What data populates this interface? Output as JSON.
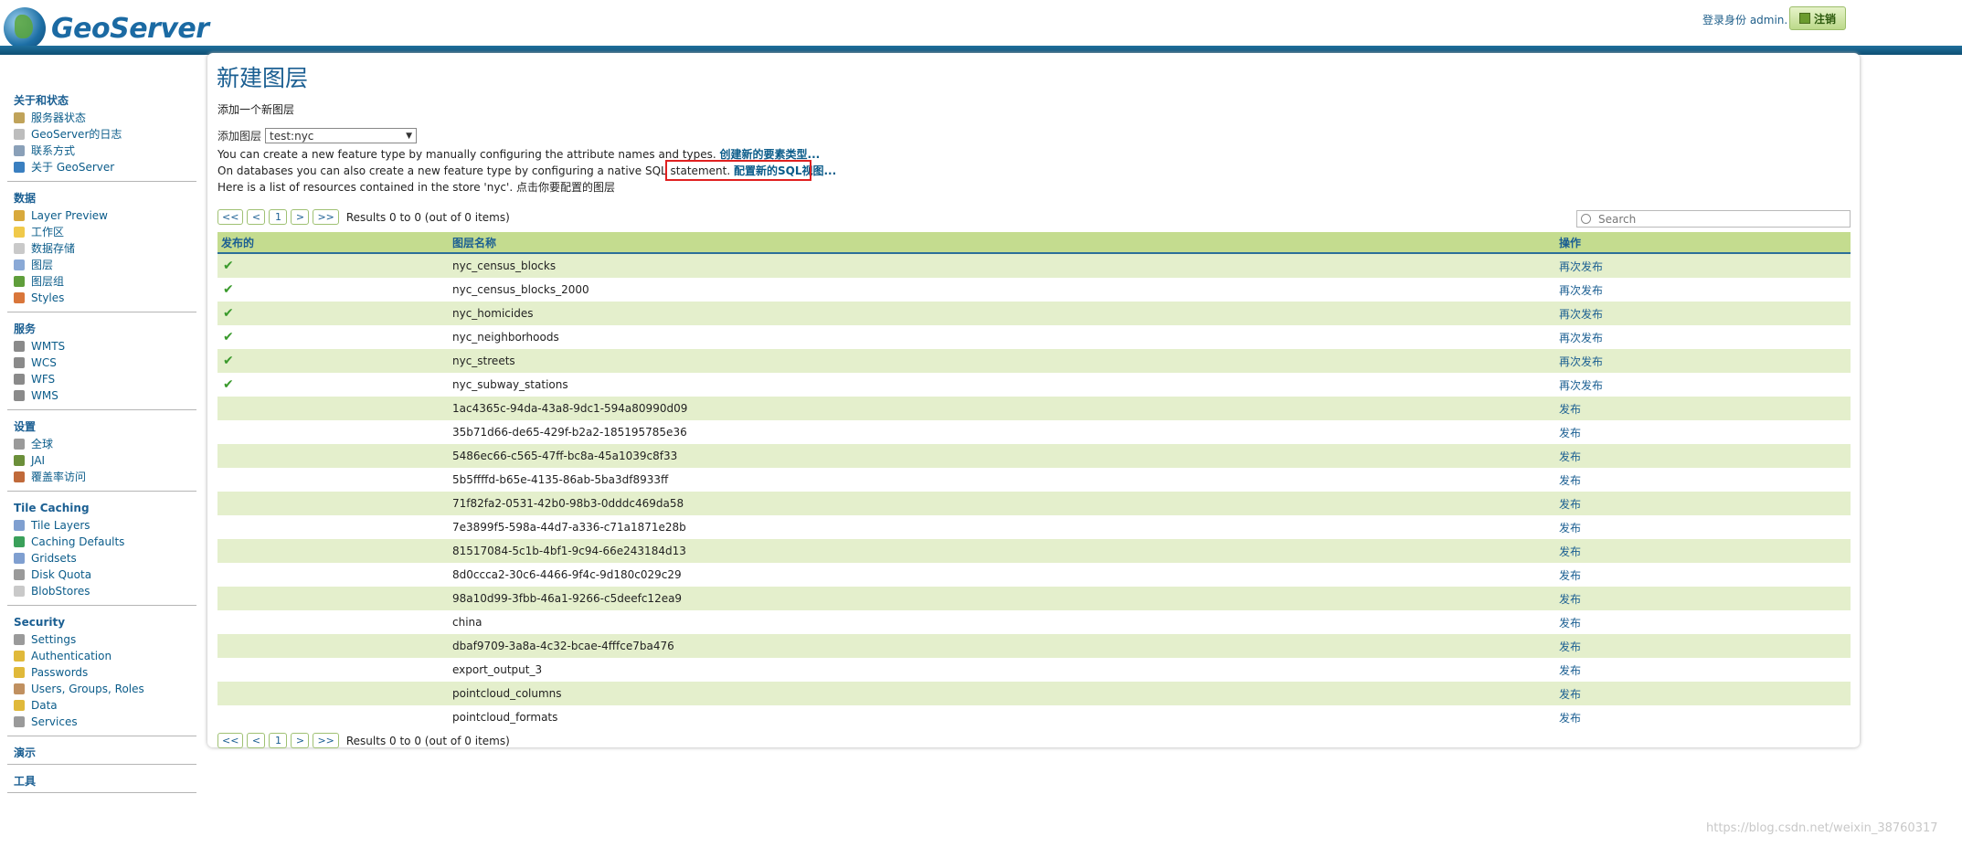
{
  "header": {
    "logo_text": "GeoServer",
    "login_text": "登录身份 admin.",
    "logout_label": "注销"
  },
  "sidebar": {
    "sections": [
      {
        "title": "关于和状态",
        "items": [
          {
            "label": "服务器状态",
            "icon": "server-status-icon",
            "color": "#c0a35a"
          },
          {
            "label": "GeoServer的日志",
            "icon": "log-icon",
            "color": "#bdbdbd"
          },
          {
            "label": "联系方式",
            "icon": "contact-icon",
            "color": "#8aa0b8"
          },
          {
            "label": "关于 GeoServer",
            "icon": "about-icon",
            "color": "#3a7fc0"
          }
        ]
      },
      {
        "title": "数据",
        "items": [
          {
            "label": "Layer Preview",
            "icon": "layer-preview-icon",
            "color": "#d8a93c"
          },
          {
            "label": "工作区",
            "icon": "folder-icon",
            "color": "#f0c94a"
          },
          {
            "label": "数据存储",
            "icon": "datastore-icon",
            "color": "#c9c9c9"
          },
          {
            "label": "图层",
            "icon": "layers-icon",
            "color": "#8aa9d6"
          },
          {
            "label": "图层组",
            "icon": "layergroup-icon",
            "color": "#5f9e3b"
          },
          {
            "label": "Styles",
            "icon": "styles-icon",
            "color": "#d9763a"
          }
        ]
      },
      {
        "title": "服务",
        "items": [
          {
            "label": "WMTS",
            "icon": "wmts-icon",
            "color": "#8a8a8a"
          },
          {
            "label": "WCS",
            "icon": "wcs-icon",
            "color": "#8a8a8a"
          },
          {
            "label": "WFS",
            "icon": "wfs-icon",
            "color": "#8a8a8a"
          },
          {
            "label": "WMS",
            "icon": "wms-icon",
            "color": "#8a8a8a"
          }
        ]
      },
      {
        "title": "设置",
        "items": [
          {
            "label": "全球",
            "icon": "global-icon",
            "color": "#9a9a9a"
          },
          {
            "label": "JAI",
            "icon": "jai-icon",
            "color": "#6b8f3a"
          },
          {
            "label": "覆盖率访问",
            "icon": "coverage-access-icon",
            "color": "#c06a3a"
          }
        ]
      },
      {
        "title": "Tile Caching",
        "items": [
          {
            "label": "Tile Layers",
            "icon": "tile-layers-icon",
            "color": "#7f9fd0"
          },
          {
            "label": "Caching Defaults",
            "icon": "caching-defaults-icon",
            "color": "#3aa05a"
          },
          {
            "label": "Gridsets",
            "icon": "gridsets-icon",
            "color": "#7f9fd0"
          },
          {
            "label": "Disk Quota",
            "icon": "disk-quota-icon",
            "color": "#9a9a9a"
          },
          {
            "label": "BlobStores",
            "icon": "blobstores-icon",
            "color": "#c9c9c9"
          }
        ]
      },
      {
        "title": "Security",
        "items": [
          {
            "label": "Settings",
            "icon": "wrench-icon",
            "color": "#9a9a9a"
          },
          {
            "label": "Authentication",
            "icon": "authentication-icon",
            "color": "#e0b93a"
          },
          {
            "label": "Passwords",
            "icon": "passwords-icon",
            "color": "#e0b93a"
          },
          {
            "label": "Users, Groups, Roles",
            "icon": "users-icon",
            "color": "#c09060"
          },
          {
            "label": "Data",
            "icon": "data-security-icon",
            "color": "#e0b93a"
          },
          {
            "label": "Services",
            "icon": "services-security-icon",
            "color": "#9a9a9a"
          }
        ]
      },
      {
        "title": "演示",
        "items": []
      },
      {
        "title": "工具",
        "items": []
      }
    ]
  },
  "main": {
    "title": "新建图层",
    "subtitle": "添加一个新图层",
    "add_layer_label": "添加图层",
    "store_value": "test:nyc",
    "line1_text": "You can create a new feature type by manually configuring the attribute names and types.",
    "line1_link": "创建新的要素类型...",
    "line2_text": "On databases you can also create a new feature type by configuring a native SQL statement.",
    "line2_link": "配置新的SQL视图...",
    "line3_text": "Here is a list of resources contained in the store 'nyc'. 点击你要配置的图层",
    "pager": {
      "first": "<<",
      "prev": "<",
      "page": "1",
      "next": ">",
      "last": ">>",
      "results": "Results 0 to 0 (out of 0 items)"
    },
    "search_placeholder": "Search",
    "columns": [
      "发布的",
      "图层名称",
      "操作"
    ],
    "rows": [
      {
        "published": true,
        "name": "nyc_census_blocks",
        "action": "再次发布"
      },
      {
        "published": true,
        "name": "nyc_census_blocks_2000",
        "action": "再次发布"
      },
      {
        "published": true,
        "name": "nyc_homicides",
        "action": "再次发布"
      },
      {
        "published": true,
        "name": "nyc_neighborhoods",
        "action": "再次发布"
      },
      {
        "published": true,
        "name": "nyc_streets",
        "action": "再次发布"
      },
      {
        "published": true,
        "name": "nyc_subway_stations",
        "action": "再次发布"
      },
      {
        "published": false,
        "name": "1ac4365c-94da-43a8-9dc1-594a80990d09",
        "action": "发布"
      },
      {
        "published": false,
        "name": "35b71d66-de65-429f-b2a2-185195785e36",
        "action": "发布"
      },
      {
        "published": false,
        "name": "5486ec66-c565-47ff-bc8a-45a1039c8f33",
        "action": "发布"
      },
      {
        "published": false,
        "name": "5b5ffffd-b65e-4135-86ab-5ba3df8933ff",
        "action": "发布"
      },
      {
        "published": false,
        "name": "71f82fa2-0531-42b0-98b3-0dddc469da58",
        "action": "发布"
      },
      {
        "published": false,
        "name": "7e3899f5-598a-44d7-a336-c71a1871e28b",
        "action": "发布"
      },
      {
        "published": false,
        "name": "81517084-5c1b-4bf1-9c94-66e243184d13",
        "action": "发布"
      },
      {
        "published": false,
        "name": "8d0ccca2-30c6-4466-9f4c-9d180c029c29",
        "action": "发布"
      },
      {
        "published": false,
        "name": "98a10d99-3fbb-46a1-9266-c5deefc12ea9",
        "action": "发布"
      },
      {
        "published": false,
        "name": "china",
        "action": "发布"
      },
      {
        "published": false,
        "name": "dbaf9709-3a8a-4c32-bcae-4fffce7ba476",
        "action": "发布"
      },
      {
        "published": false,
        "name": "export_output_3",
        "action": "发布"
      },
      {
        "published": false,
        "name": "pointcloud_columns",
        "action": "发布"
      },
      {
        "published": false,
        "name": "pointcloud_formats",
        "action": "发布"
      }
    ],
    "check_mark": "✔"
  },
  "watermark": "https://blog.csdn.net/weixin_38760317"
}
